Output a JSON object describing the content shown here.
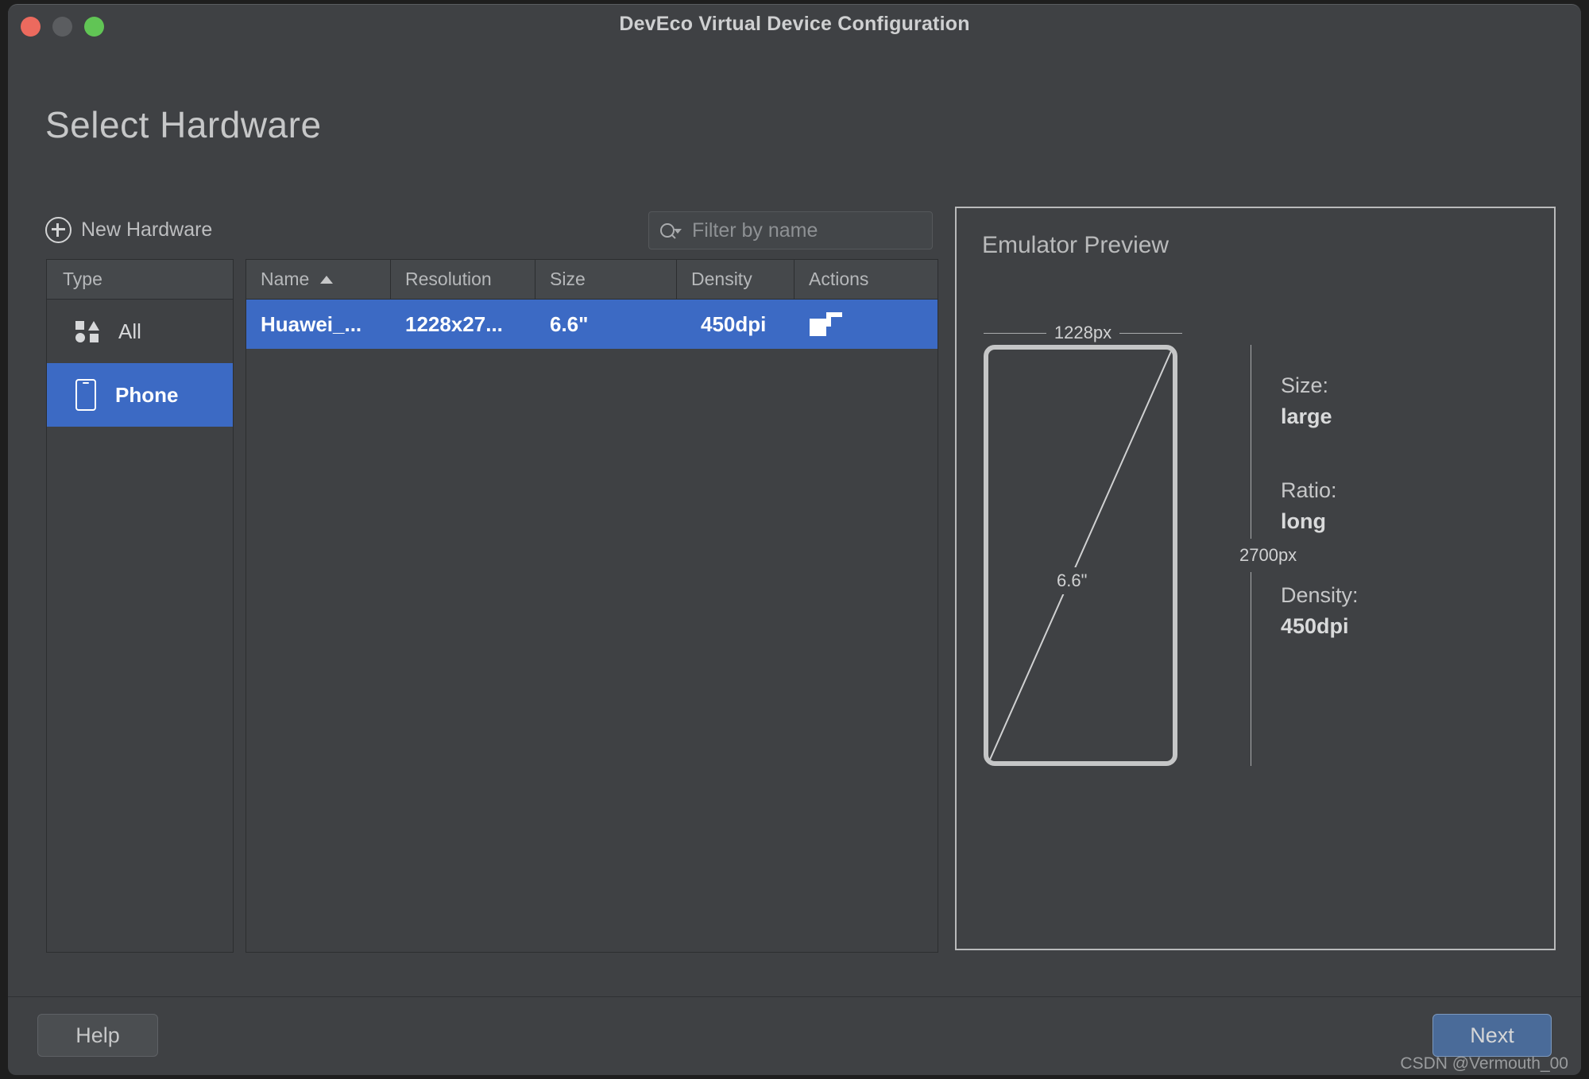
{
  "window": {
    "title": "DevEco Virtual Device Configuration",
    "traffic_lights": [
      "close",
      "minimize",
      "maximize"
    ],
    "accent_blue": "#3c6ac4",
    "next_button_blue": "#4a6b99",
    "background": "#3f4144"
  },
  "page": {
    "heading": "Select Hardware"
  },
  "toolbar": {
    "new_hardware_label": "New Hardware",
    "new_hardware_icon": "plus-circle-icon",
    "filter": {
      "value": "",
      "placeholder": "Filter by name",
      "icon": "search-icon",
      "caret_icon": "chevron-down-icon"
    }
  },
  "type_panel": {
    "header": "Type",
    "items": [
      {
        "label": "All",
        "icon": "shapes-icon",
        "selected": false
      },
      {
        "label": "Phone",
        "icon": "phone-icon",
        "selected": true
      }
    ]
  },
  "device_table": {
    "columns": [
      {
        "label": "Name",
        "sort": "ascending",
        "sort_icon": "triangle-up-icon"
      },
      {
        "label": "Resolution"
      },
      {
        "label": "Size"
      },
      {
        "label": "Density"
      },
      {
        "label": "Actions"
      }
    ],
    "rows": [
      {
        "name": "Huawei_...",
        "resolution": "1228x27...",
        "size": "6.6\"",
        "density": "450dpi",
        "action_icon": "duplicate-icon",
        "selected": true
      }
    ]
  },
  "preview": {
    "title": "Emulator Preview",
    "width_label": "1228px",
    "height_label": "2700px",
    "diagonal_label": "6.6\"",
    "specs": [
      {
        "label": "Size:",
        "value": "large"
      },
      {
        "label": "Ratio:",
        "value": "long"
      },
      {
        "label": "Density:",
        "value": "450dpi"
      }
    ]
  },
  "footer": {
    "help_label": "Help",
    "next_label": "Next"
  },
  "watermark": "CSDN @Vermouth_00"
}
